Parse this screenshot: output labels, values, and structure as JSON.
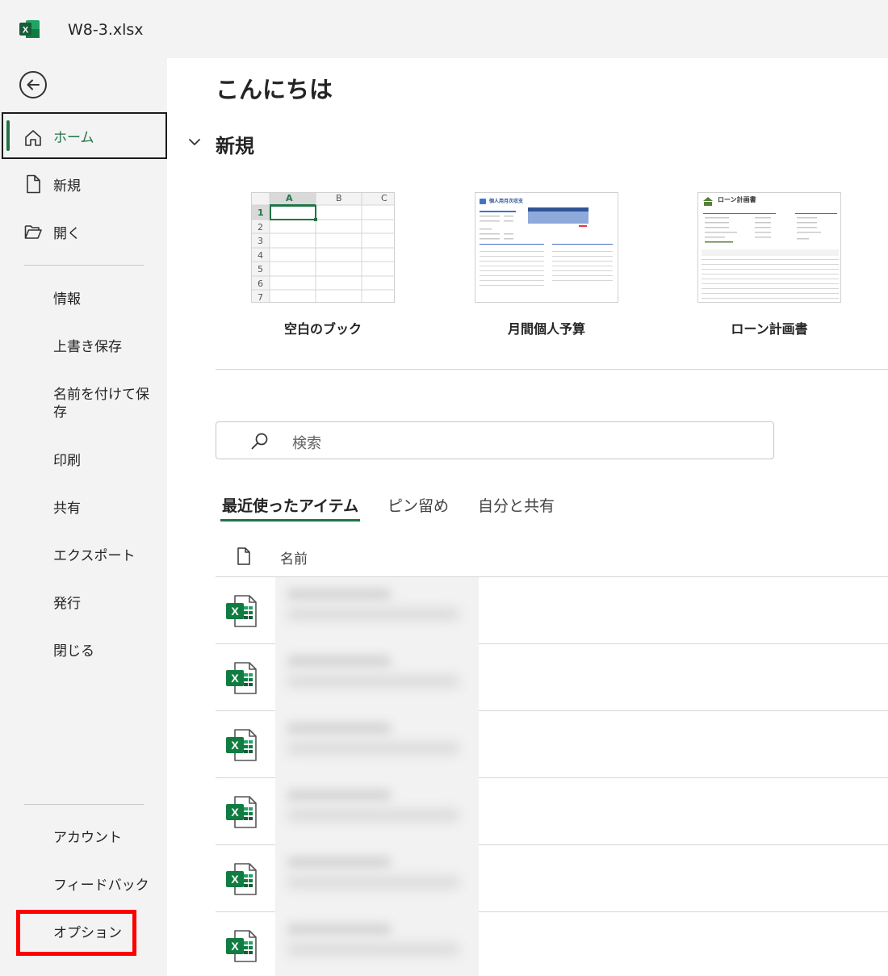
{
  "window": {
    "title": "W8-3.xlsx"
  },
  "sidebar": {
    "home": "ホーム",
    "new": "新規",
    "open": "開く",
    "info": "情報",
    "save": "上書き保存",
    "save_as": "名前を付けて保存",
    "print": "印刷",
    "share": "共有",
    "export": "エクスポート",
    "publish": "発行",
    "close": "閉じる",
    "account": "アカウント",
    "feedback": "フィードバック",
    "options": "オプション"
  },
  "main": {
    "greeting": "こんにちは",
    "new_section": "新規",
    "templates": [
      {
        "label": "空白のブック"
      },
      {
        "label": "月間個人予算"
      },
      {
        "label": "ローン計画書"
      }
    ],
    "blank_thumb": {
      "columns": [
        "A",
        "B",
        "C"
      ],
      "rows": [
        "1",
        "2",
        "3",
        "4",
        "5",
        "6",
        "7"
      ]
    },
    "budget_thumb_title": "個人用月次収支",
    "loan_thumb_title": "ローン計画書",
    "search": {
      "placeholder": "検索"
    },
    "tabs": [
      {
        "label": "最近使ったアイテム"
      },
      {
        "label": "ピン留め"
      },
      {
        "label": "自分と共有"
      }
    ],
    "list_header": {
      "name": "名前"
    }
  },
  "colors": {
    "accent": "#217346",
    "highlight_box": "#ff0000"
  },
  "icons": [
    "excel-app-icon",
    "back-arrow-icon",
    "home-icon",
    "new-doc-icon",
    "open-folder-icon",
    "chevron-down-icon",
    "search-icon",
    "document-icon",
    "excel-file-icon"
  ]
}
